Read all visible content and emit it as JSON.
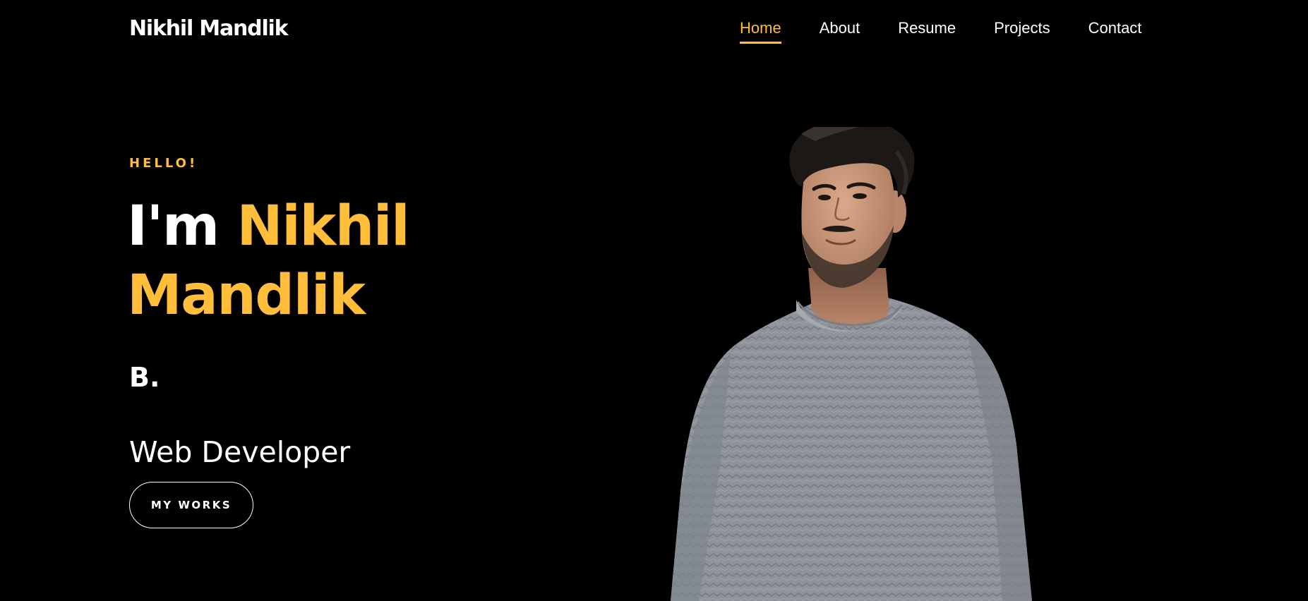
{
  "header": {
    "brand": "Nikhil Mandlik",
    "nav": [
      {
        "label": "Home",
        "active": true
      },
      {
        "label": "About",
        "active": false
      },
      {
        "label": "Resume",
        "active": false
      },
      {
        "label": "Projects",
        "active": false
      },
      {
        "label": "Contact",
        "active": false
      }
    ]
  },
  "hero": {
    "greeting": "HELLO!",
    "title_prefix": "I'm",
    "title_name_first": "Nikhil",
    "title_name_last": "Mandlik",
    "initial": "B.",
    "role": "Web Developer",
    "cta_label": "MY WORKS"
  },
  "colors": {
    "background": "#000000",
    "accent": "#ffbd39",
    "text": "#ffffff",
    "sweater": "#8e939b",
    "hair": "#1b1816",
    "skin": "#c9987a"
  },
  "icons": {
    "portrait": "person-photo"
  }
}
